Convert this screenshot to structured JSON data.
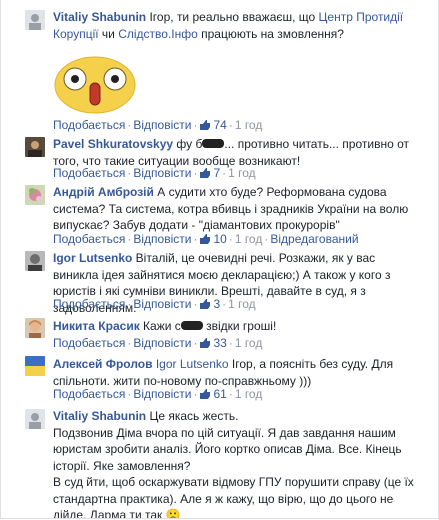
{
  "comments": [
    {
      "author": "Vitaliy Shabunin",
      "text1": " Ігор, ти реально вважаєш, що ",
      "link1": "Центр Протидії Корупції",
      "text2": " чи ",
      "link2": "Слідство.Інфо",
      "text3": " працюють на змовлення?",
      "actions": {
        "like": "Подобається",
        "reply": "Відповісти",
        "likes": "74",
        "time": "1 год"
      }
    },
    {
      "author": "Pavel Shkuratovskyy",
      "text1": " фу б",
      "text2": "... противно читать... противно от того, что такие ситуации вообще возникают!",
      "actions": {
        "like": "Подобається",
        "reply": "Відповісти",
        "likes": "7",
        "time": "1 год"
      }
    },
    {
      "author": "Андрій Амброзій",
      "text1": " А судити хто буде? Реформована судова система? Та система, котра вбивць і зрадників України на волю випускає? Забув додати - \"діамантових прокурорів\"",
      "actions": {
        "like": "Подобається",
        "reply": "Відповісти",
        "likes": "10",
        "time": "1 год",
        "edited": "Відредагований"
      }
    },
    {
      "author": "Igor Lutsenko",
      "text1": " Віталій, це очевидні речі. Розкажи, як у вас виникла ідея зайнятися моєю декларацією;) А також у кого з юристів і які сумніви виникли. Врешті, давайте в суд, я з задоволенням.",
      "actions": {
        "like": "Подобається",
        "reply": "Відповісти",
        "likes": "3",
        "time": "1 год"
      }
    },
    {
      "author": "Никита Красик",
      "text1": " Кажи с",
      "text2": " звідки гроші!",
      "actions": {
        "like": "Подобається",
        "reply": "Відповісти",
        "likes": "33",
        "time": "1 год"
      }
    },
    {
      "author": "Алексей Фролов",
      "mention": "Igor Lutsenko",
      "text1": " Ігор, а поясніть без суду. Для спільноти. жити по-новому по-справжньому )))",
      "actions": {
        "like": "Подобається",
        "reply": "Відповісти",
        "likes": "61",
        "time": "1 год"
      }
    },
    {
      "author": "Vitaliy Shabunin",
      "text1": " Це якась жесть.",
      "text2": "Подзвонив Діма вчора по цій ситуації. Я дав завдання нашим юристам зробити аналіз. Його кортко описав Діма. Все. Кінець історії. Яке замовлення?",
      "text3": "В суд йти, щоб оскаржувати відмову ГПУ порушити справу (це їх стандартна практика). Але я ж кажу, що вірю, що до цього не дійде. Дарма ти так",
      "emoji": "🙁"
    }
  ],
  "colors": {
    "link": "#365899",
    "meta": "#90949c",
    "text": "#1d2129"
  },
  "icons": {
    "like": "thumbs-up-icon",
    "sticker": "shocked-face-sticker"
  }
}
